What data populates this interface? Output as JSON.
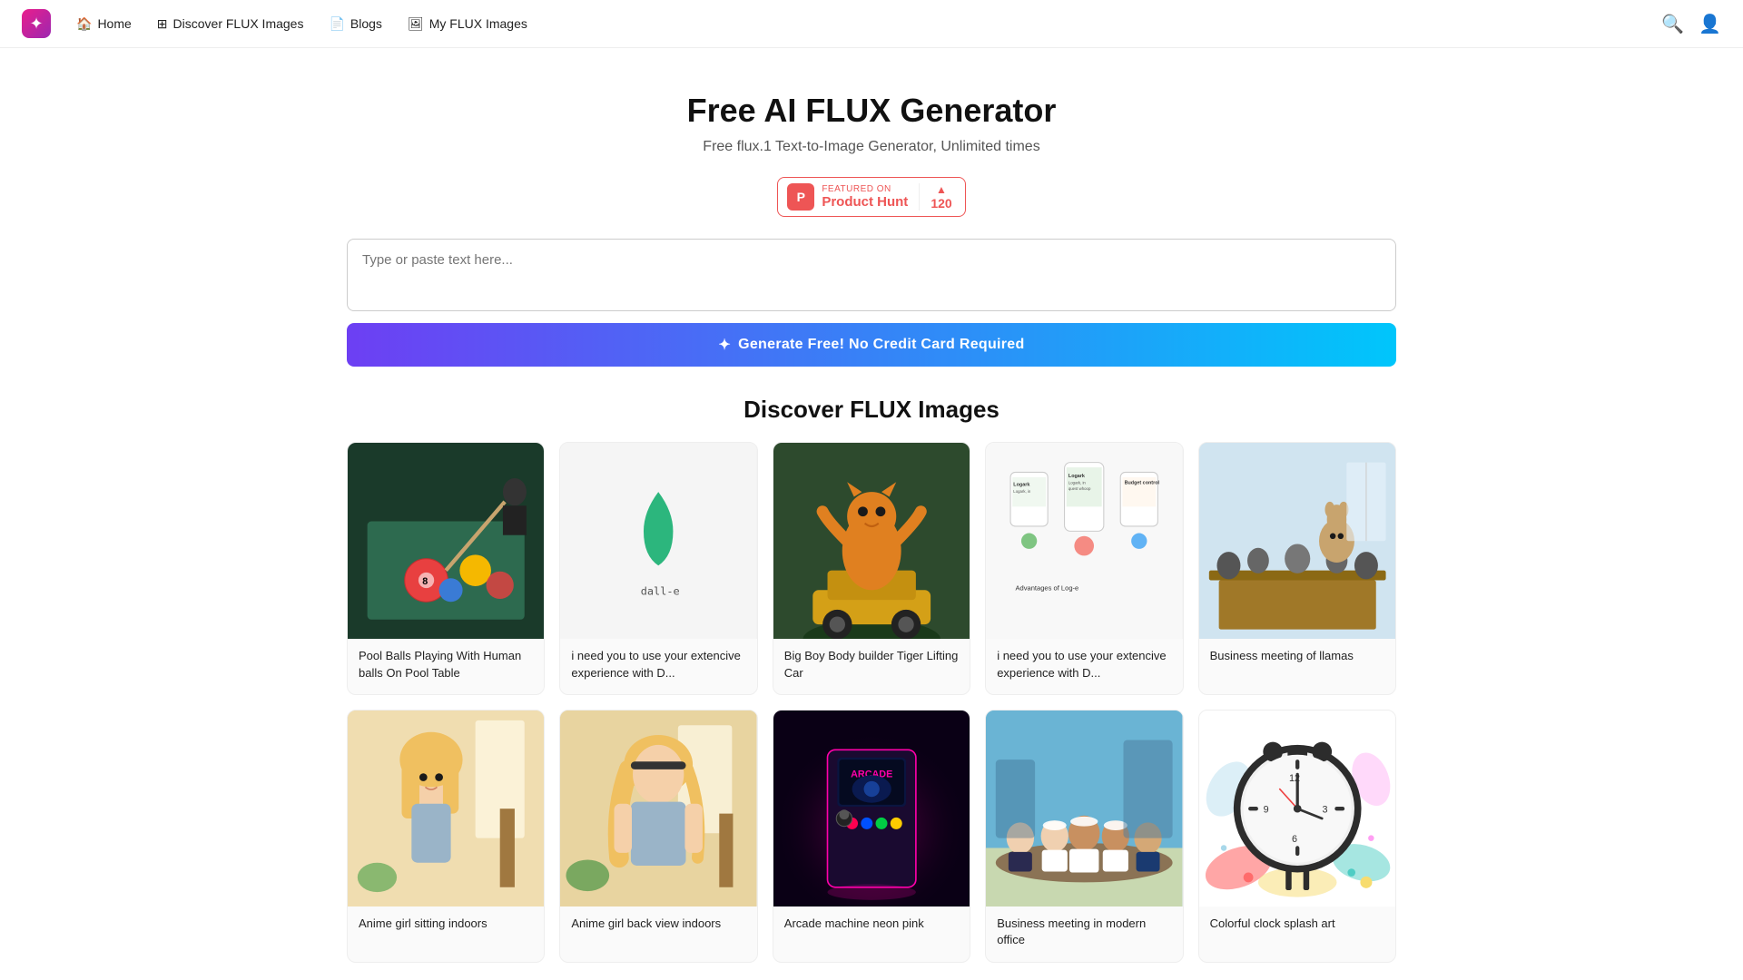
{
  "app": {
    "logo_char": "✦",
    "title": "Free AI FLUX Generator"
  },
  "nav": {
    "home_label": "Home",
    "discover_label": "Discover FLUX Images",
    "blogs_label": "Blogs",
    "my_images_label": "My FLUX Images"
  },
  "hero": {
    "title": "Free AI FLUX Generator",
    "subtitle": "Free flux.1 Text-to-Image Generator, Unlimited times"
  },
  "product_hunt": {
    "featured_label": "FEATURED ON",
    "name": "Product Hunt",
    "count": "120",
    "logo": "P"
  },
  "prompt": {
    "placeholder": "Type or paste text here..."
  },
  "generate_button": {
    "label": "Generate Free! No Credit Card Required"
  },
  "discover": {
    "title": "Discover FLUX Images",
    "cards_row1": [
      {
        "id": "pool",
        "title": "Pool Balls Playing With Human balls On Pool Table",
        "color": "pool"
      },
      {
        "id": "dalle",
        "title": "i need you to use your extencive experience with D...",
        "color": "dalle"
      },
      {
        "id": "tiger",
        "title": "Big Boy Body builder Tiger Lifting Car",
        "color": "tiger"
      },
      {
        "id": "logark",
        "title": "i need you to use your extencive experience with D...",
        "color": "logark"
      },
      {
        "id": "llama",
        "title": "Business meeting of llamas",
        "color": "llama"
      }
    ],
    "cards_row2": [
      {
        "id": "anime1",
        "title": "Anime girl sitting indoors",
        "color": "anime1"
      },
      {
        "id": "anime2",
        "title": "Anime girl back view indoors",
        "color": "anime2"
      },
      {
        "id": "arcade",
        "title": "Arcade machine neon pink",
        "color": "arcade"
      },
      {
        "id": "meeting",
        "title": "Business meeting in modern office",
        "color": "meeting"
      },
      {
        "id": "clock",
        "title": "Colorful clock splash art",
        "color": "clock"
      }
    ]
  }
}
